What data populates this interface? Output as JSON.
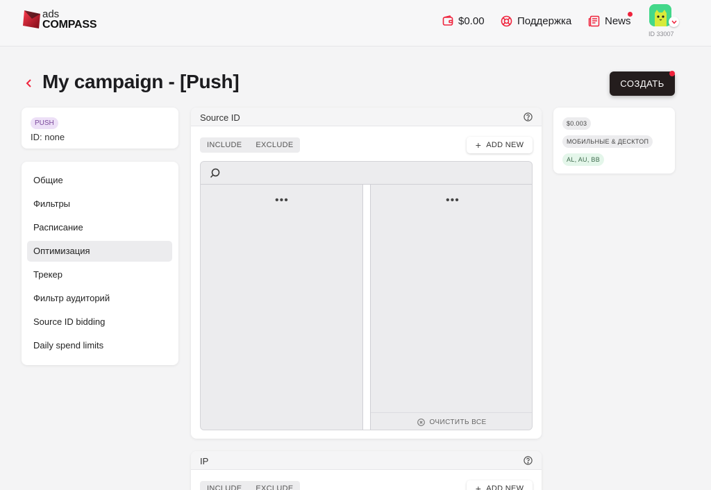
{
  "brand": {
    "ads": "ads",
    "name": "COMPASS"
  },
  "header": {
    "balance": "$0.00",
    "support": "Поддержка",
    "news": "News",
    "user_id": "ID 33007"
  },
  "page": {
    "title": "My campaign - [Push]",
    "create_label": "СОЗДАТЬ"
  },
  "campaign_info": {
    "type": "PUSH",
    "id_text": "ID: none"
  },
  "nav": {
    "active_index": 3,
    "items": [
      "Общие",
      "Фильтры",
      "Расписание",
      "Оптимизация",
      "Трекер",
      "Фильтр аудиторий",
      "Source ID bidding",
      "Daily spend limits"
    ]
  },
  "source_panel": {
    "title": "Source ID",
    "include": "INCLUDE",
    "exclude": "EXCLUDE",
    "add_new": "ADD NEW",
    "search_placeholder": "",
    "loading_left": "•••",
    "loading_right": "•••",
    "clear_all": "ОЧИСТИТЬ ВСЕ"
  },
  "ip_panel": {
    "title": "IP",
    "include": "INCLUDE",
    "exclude": "EXCLUDE",
    "add_new": "ADD NEW"
  },
  "summary": {
    "price": "$0.003",
    "devices": "МОБИЛЬНЫЕ & ДЕСКТОП",
    "geo": "AL, AU, BB"
  },
  "colors": {
    "accent": "#ef233c",
    "create_button": "#241d1d",
    "push_pill": "#ede0f7",
    "geo_tag": "#e4f6ea"
  }
}
